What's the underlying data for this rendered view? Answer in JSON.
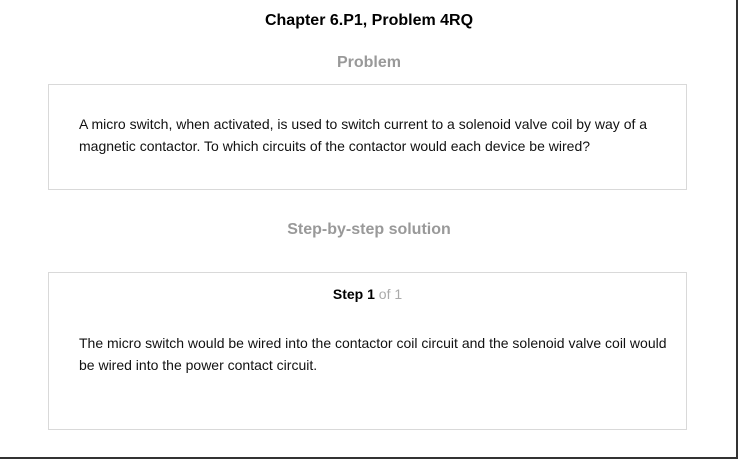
{
  "header": {
    "chapter_title": "Chapter 6.P1, Problem 4RQ"
  },
  "problem": {
    "heading": "Problem",
    "text": "A micro switch, when activated, is used to switch current to a solenoid valve coil by way of a magnetic contactor. To which circuits of the contactor would each device be wired?"
  },
  "solution": {
    "heading": "Step-by-step solution",
    "step": {
      "word": "Step",
      "number": "1",
      "of_total": "of 1",
      "text": "The micro switch would be wired into the contactor coil circuit and the solenoid valve coil would be wired into the power contact circuit."
    }
  },
  "colors": {
    "heading_gray": "#999999",
    "card_border": "#d9d9d9",
    "step_of_gray": "#aaaaaa"
  }
}
